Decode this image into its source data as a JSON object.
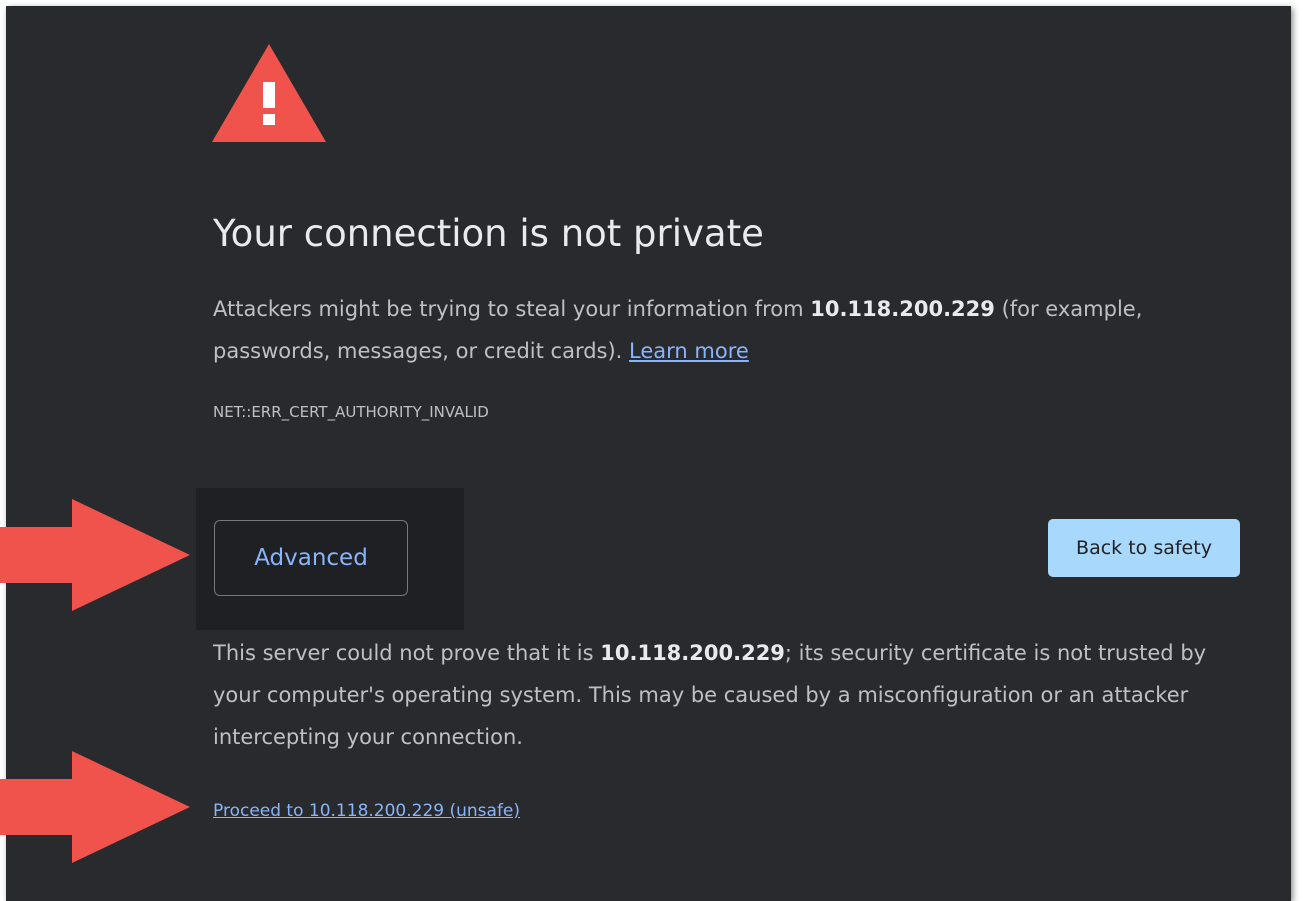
{
  "page": {
    "icon": "warning-triangle-icon",
    "title": "Your connection is not private",
    "intro": {
      "text_before": "Attackers might be trying to steal your information from ",
      "host": "10.118.200.229",
      "text_after": " (for example, passwords, messages, or credit cards). ",
      "learn_more": "Learn more"
    },
    "error_code": "NET::ERR_CERT_AUTHORITY_INVALID",
    "buttons": {
      "advanced": "Advanced",
      "back_to_safety": "Back to safety"
    },
    "details": {
      "text_before": "This server could not prove that it is ",
      "host": "10.118.200.229",
      "text_after": "; its security certificate is not trusted by your computer's operating system. This may be caused by a misconfiguration or an attacker intercepting your connection."
    },
    "proceed_link": "Proceed to 10.118.200.229 (unsafe)"
  },
  "annotations": {
    "arrow_icon": "red-arrow-icon",
    "arrow_color": "#f0534b"
  },
  "colors": {
    "background": "#292a2e",
    "warning_red": "#f0534b",
    "link_blue": "#8ab4f8",
    "safety_button": "#a8d8fb"
  }
}
